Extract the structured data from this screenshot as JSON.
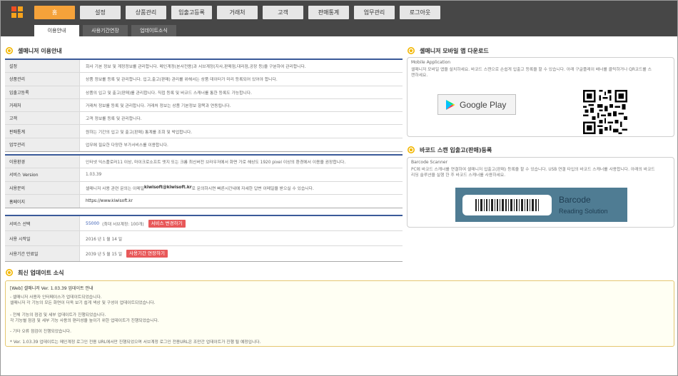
{
  "nav": {
    "menu": [
      "홈",
      "설정",
      "상품관리",
      "입출고등록",
      "거래처",
      "고객",
      "판매통계",
      "업무관리",
      "로그아웃"
    ],
    "active": 0
  },
  "tabs": [
    "이용안내",
    "사용기간연장",
    "업데이트소식"
  ],
  "guide": {
    "title": "셀매니저 이용안내",
    "rows": [
      {
        "k": "설정",
        "v": "회사 기본 정보 및 계정정보를 관리합니다. 메인계정(본사전용)과 서브계정(지사,판매점,대리점,공장 등)을 구분하여 관리합니다."
      },
      {
        "k": "상품관리",
        "v": "상품 정보를 등록 및 관리합니다. 입고,출고(판매) 관리를 위해서는 상품 데이터가 미리 등록되어 있어야 합니다."
      },
      {
        "k": "입출고등록",
        "v": "상품의 입고 및 출고(판매)를 관리합니다. 직접 등록 및 바코드 스캐너를 통한 등록도 가능합니다."
      },
      {
        "k": "거래처",
        "v": "거래처 정보를 등록 및 관리합니다. 거래처 정보는 상품 기본정보 항목과 연동됩니다."
      },
      {
        "k": "고객",
        "v": "고객 정보를 등록 및 관리합니다."
      },
      {
        "k": "판매통계",
        "v": "원하는 기간의 입고 및 출고(판매) 통계를 조회 및 박업합니다."
      },
      {
        "k": "업무관리",
        "v": "업무에 필요한 다양한 부가서비스를 이용합니다."
      }
    ]
  },
  "info": {
    "rows": [
      {
        "k": "이용환경",
        "v": "인터넷 익스플로러11 이상, 마이크로소프트 엣지 또는 크롬 최신버전 브라우저에서 화면 가로 해상도 1920 pixel 이상의 환경에서 이용을 권장합니다."
      },
      {
        "k": "서비스 Version",
        "v": "1.03.39"
      },
      {
        "k": "사용문의",
        "v_pre": "셀매니저 사용 관련 문의는 이메일 ",
        "v_email": "kiwisoft@kiwisoft.kr",
        "v_post": " 로 문의하시면 빠른시간내에 자세한 답변 이메일을 받으실 수 있습니다."
      },
      {
        "k": "홈페이지",
        "v": "https://www.kiwisoft.kr"
      }
    ]
  },
  "service": {
    "rows": [
      {
        "k": "서비스 선택",
        "value": "55000",
        "note": "(최대 서브계정: 100개)",
        "button": "서비스 변경하기"
      },
      {
        "k": "사용 시작일",
        "value": "2016 년 1 월 14 일"
      },
      {
        "k": "사용기간 만료일",
        "value": "2039 년 5 월 15 일",
        "button": "사용기간 연장하기"
      }
    ]
  },
  "mobile": {
    "title": "셀매니저 모바일 앱 다운로드",
    "label": "Mobile Application",
    "desc1": "셀매니저 모바일 앱을 설치하세요. 바코드 스캔으로 손쉽게 입출고 등록을 할 수 있습니다. 아래 구글플레이 배너를 클릭하거나 QR코드를 스",
    "desc2": "캔하세요.",
    "gplay": "Google Play"
  },
  "barcode": {
    "title": "바코드 스캔 입출고(판매)등록",
    "label": "Barcode Scanner",
    "desc1": "PC에 바코드 스캐너를 연결하여 셀매니저 입출고(판매) 등록을 할 수 있습니다. USB 연결 타입의 바코드 스캐너를 사용합니다. 아래의 바코드",
    "desc2": "리딩 솔루션을 실행 한 후 바코드 스캐너를 사용하세요.",
    "banner_title": "Barcode",
    "banner_sub": "Reading Solution"
  },
  "updates": {
    "title": "최신 업데이트 소식",
    "heading": "[Web] 셀매니저 Ver. 1.03.39 업데이트 안내",
    "lines": [
      "- 셀매니저 사용자 인터페이스가 업데이트되었습니다.",
      "셀매니저 각 기능의 모든 화면이 더욱 보기 쉽게 색상 및 구성이 업데이트되었습니다.",
      "- 전체 기능의 점검 및 세부 업데이트가 진행되었습니다.",
      "각 기능별 점검 및 세부 기능 사용의 편리성을 높이기 위한 업데이트가 진행되었습니다.",
      "- 기타 오류 점검이 진행되었습니다.",
      "* Ver. 1.03.39 업데이트는 메인계정 로그인 전용 URL에서만 진행되었으며 서브계정 로그인 전용URL은 조만간 업데이트가 진행 될 예정입니다."
    ]
  },
  "colors": {
    "accent": "#f5a23a",
    "nav_bg": "#474747",
    "table_head": "#3a5a99",
    "button_red": "#e8595a",
    "link": "#3b5fb5"
  }
}
